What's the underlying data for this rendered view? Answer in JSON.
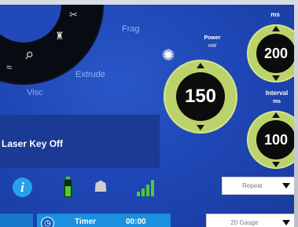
{
  "dial": {
    "modes": {
      "frag": "Frag",
      "extrude": "Extrude",
      "visc": "Visc"
    },
    "icons": [
      "scissors-icon",
      "tower-icon",
      "probe-icon",
      "wave-icon"
    ]
  },
  "power": {
    "label": "Power",
    "unit": "mW",
    "value": "150",
    "icon": "laser-burst-icon"
  },
  "duration": {
    "unit": "ms",
    "value": "200"
  },
  "interval": {
    "label": "Interval",
    "unit": "ms",
    "value": "100"
  },
  "laser_key": {
    "status": "Laser Key Off"
  },
  "toolbar": {
    "info": "i",
    "battery_icon": "battery-icon",
    "mask_icon": "mask-icon",
    "signal_icon": "signal-strength-icon"
  },
  "repeat_select": {
    "value": "Repeat"
  },
  "gauge_select": {
    "value": "20 Gauge"
  },
  "timer": {
    "label": "Timer",
    "value": "00:00"
  },
  "colors": {
    "background": "#1f47b6",
    "knob_ring": "#bcd36b",
    "knob_center": "#0c0c0c",
    "accent": "#27a2e8",
    "battery": "#48d12c"
  }
}
